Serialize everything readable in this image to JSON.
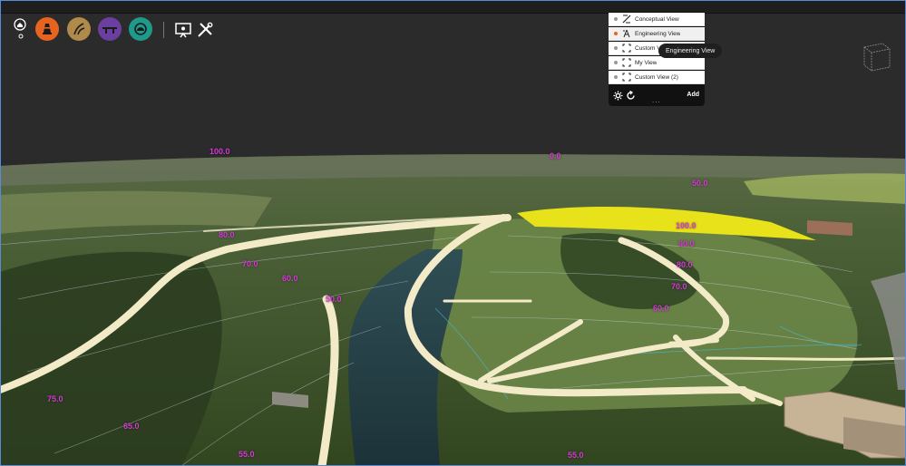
{
  "toolbar": {
    "tools": [
      {
        "icon": "road-cone-icon",
        "color": "#e8631f"
      },
      {
        "icon": "alignment-icon",
        "color": "#b08a4a"
      },
      {
        "icon": "bridge-icon",
        "color": "#6b3fa0"
      },
      {
        "icon": "tunnel-icon",
        "color": "#1d9a8c"
      }
    ]
  },
  "views": {
    "items": [
      {
        "label": "Conceptual View",
        "icon": "conceptual-view-icon",
        "active": false
      },
      {
        "label": "Engineering View",
        "icon": "engineering-view-icon",
        "active": true
      },
      {
        "label": "Custom View",
        "icon": "custom-view-icon",
        "active": false
      },
      {
        "label": "My View",
        "icon": "custom-view-icon",
        "active": false
      },
      {
        "label": "Custom View (2)",
        "icon": "custom-view-icon",
        "active": false
      }
    ],
    "add_label": "Add",
    "more": "...",
    "tooltip": "Engineering View"
  },
  "contour_labels": [
    "100.0",
    "0.0",
    "50.0",
    "100.0",
    "90.0",
    "80.0",
    "80.0",
    "70.0",
    "60.0",
    "50.0",
    "70.0",
    "60.0",
    "75.0",
    "65.0",
    "55.0",
    "55.0"
  ],
  "colors": {
    "contour_label": "#d63ad6",
    "road": "#f3ebc8",
    "accent": "#e8631f"
  }
}
